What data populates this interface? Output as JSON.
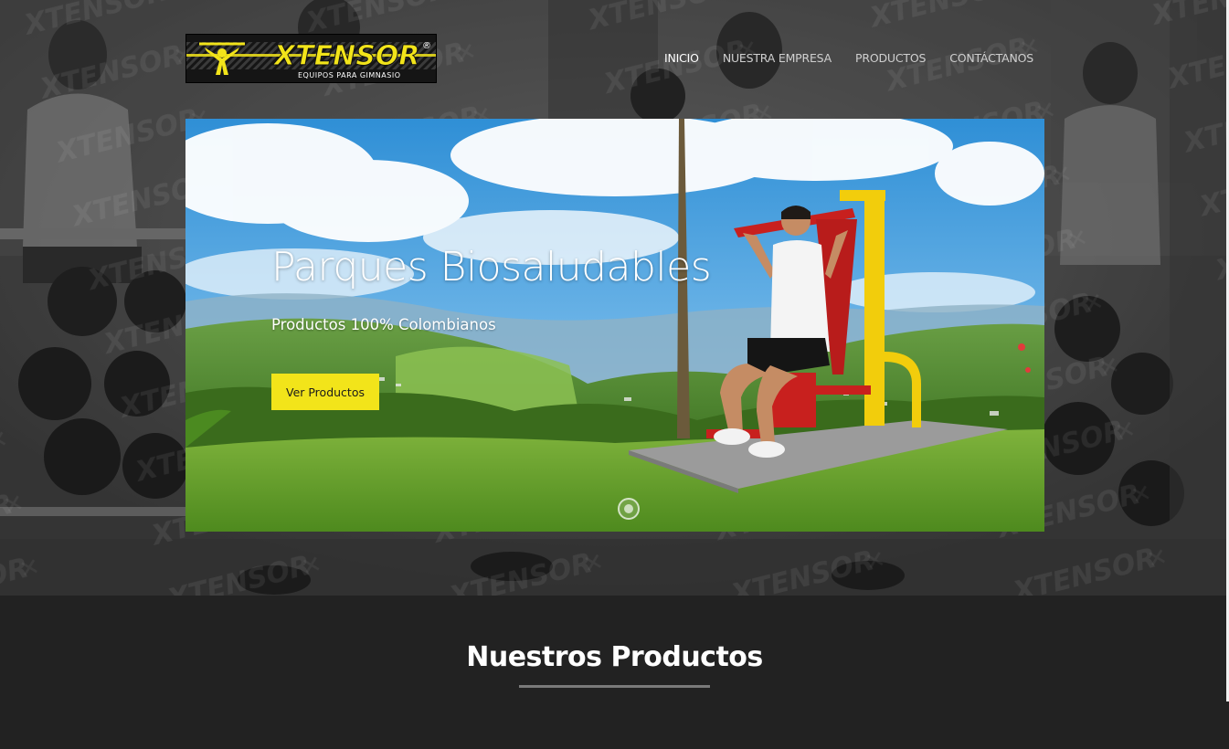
{
  "brand": {
    "name": "XTENSOR",
    "tagline": "EQUIPOS PARA GIMNASIO",
    "registered_mark": "®",
    "logo_icon": "lifter-figure-icon",
    "accent_color": "#f2e41a"
  },
  "nav": {
    "items": [
      {
        "label": "INICIO",
        "active": true
      },
      {
        "label": "NUESTRA EMPRESA",
        "active": false
      },
      {
        "label": "PRODUCTOS",
        "active": false
      },
      {
        "label": "CONTÁCTANOS",
        "active": false
      }
    ]
  },
  "slider": {
    "title": "Parques Biosaludables",
    "subtitle": "Productos 100% Colombianos",
    "button_label": "Ver Productos",
    "button_color": "#f2e41a"
  },
  "products": {
    "heading": "Nuestros Productos"
  }
}
